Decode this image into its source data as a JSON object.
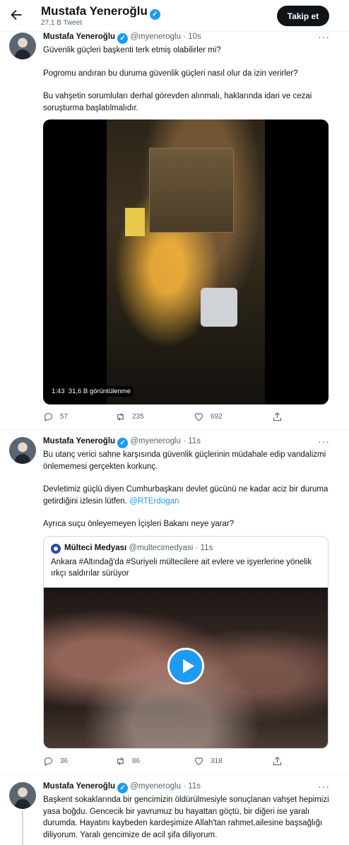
{
  "header": {
    "name": "Mustafa Yeneroğlu",
    "tweet_count": "27,1 B Tweet",
    "follow_label": "Takip et"
  },
  "tweets": [
    {
      "name": "Mustafa Yeneroğlu",
      "handle": "@myeneroglu",
      "sep": "·",
      "time": "10s",
      "paragraphs": [
        "Güvenlik güçleri başkenti terk etmiş olabilirler mi?",
        "Pogromu andıran bu duruma güvenlik güçleri nasıl olur da izin verirler?",
        "Bu vahşetin sorumluları derhal görevden alınmalı, haklarında idari ve cezai soruşturma başlatılmalıdır."
      ],
      "video": {
        "duration": "1:43",
        "views": "31,6 B görüntülenme"
      },
      "replies": "57",
      "retweets": "235",
      "likes": "692"
    },
    {
      "name": "Mustafa Yeneroğlu",
      "handle": "@myeneroglu",
      "sep": "·",
      "time": "11s",
      "paragraphs": [
        "Bu utanç verici sahne karşısında güvenlik güçlerinin müdahale edip vandalizmi önlememesi gerçekten korkunç.",
        "Devletimiz güçlü diyen Cumhurbaşkanı devlet gücünü ne kadar aciz bir duruma getirdiğini izlesin lütfen.",
        "Ayrıca suçu önleyemeyen İçişleri Bakanı neye yarar?"
      ],
      "mention": "@RTErdogan",
      "quote": {
        "name": "Mülteci Medyası",
        "handle": "@multecimedyasi",
        "sep": "·",
        "time": "11s",
        "text": "Ankara #Altındağ'da #Suriyeli mültecilere ait evlere ve işyerlerine yönelik ırkçı saldırılar sürüyor"
      },
      "replies": "36",
      "retweets": "86",
      "likes": "318"
    },
    {
      "name": "Mustafa Yeneroğlu",
      "handle": "@myeneroglu",
      "sep": "·",
      "time": "11s",
      "paragraphs": [
        "Başkent sokaklarında bir gencimizin öldürülmesiyle sonuçlanan vahşet hepimizi yasa boğdu. Gencecik bir yavrumuz bu hayattan göçtü, bir diğeri ise yaralı durumda. Hayatını kaybeden kardeşimize Allah'tan rahmet,ailesine başsağlığı diliyorum. Yaralı gencimize de acil şifa diliyorum."
      ]
    }
  ],
  "icons": {
    "back": "arrow-left-icon",
    "verified": "verified-badge-icon",
    "reply": "reply-icon",
    "retweet": "retweet-icon",
    "like": "heart-icon",
    "share": "share-icon",
    "more": "more-icon",
    "play": "play-icon"
  },
  "colors": {
    "accent": "#1d9bf0",
    "text": "#0f1419",
    "muted": "#536471",
    "follow_bg": "#0f1419"
  }
}
